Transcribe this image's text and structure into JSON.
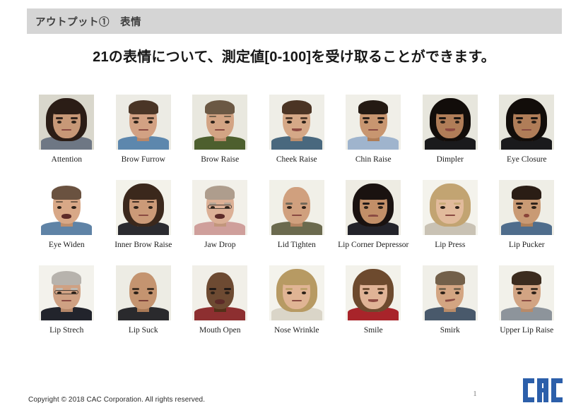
{
  "header": {
    "title": "アウトプット①　表情"
  },
  "slide": {
    "title": "21の表情について、測定値[0-100]を受け取ることができます。"
  },
  "grid": {
    "rows": [
      [
        {
          "label": "Attention",
          "photo": "portrait-attention",
          "skin": "#c79877",
          "hair": "#2b1d16",
          "bg": "#d9d7cc",
          "cloth": "#6e7784",
          "hairstyle": "long",
          "mouth": "closed"
        },
        {
          "label": "Brow Furrow",
          "photo": "portrait-brow-furrow",
          "skin": "#d2a183",
          "hair": "#4a3526",
          "bg": "#ecebe4",
          "cloth": "#5d87ad",
          "hairstyle": "short",
          "mouth": "closed"
        },
        {
          "label": "Brow Raise",
          "photo": "portrait-brow-raise",
          "skin": "#d3a484",
          "hair": "#6b5844",
          "bg": "#e9e8df",
          "cloth": "#4d5f2e",
          "hairstyle": "short",
          "mouth": "closed"
        },
        {
          "label": "Cheek Raise",
          "photo": "portrait-cheek-raise",
          "skin": "#d5a887",
          "hair": "#4b3424",
          "bg": "#efeee7",
          "cloth": "#49687e",
          "hairstyle": "short",
          "mouth": "smile"
        },
        {
          "label": "Chin Raise",
          "photo": "portrait-chin-raise",
          "skin": "#c89670",
          "hair": "#241a13",
          "bg": "#f0efe8",
          "cloth": "#9fb4cd",
          "hairstyle": "short",
          "mouth": "press"
        },
        {
          "label": "Dimpler",
          "photo": "portrait-dimpler",
          "skin": "#b07d58",
          "hair": "#120d0a",
          "bg": "#e7e6dd",
          "cloth": "#1a1a1c",
          "hairstyle": "long",
          "mouth": "smile"
        },
        {
          "label": "Eye Closure",
          "photo": "portrait-eye-closure",
          "skin": "#b07d58",
          "hair": "#120d0a",
          "bg": "#e7e6dd",
          "cloth": "#1a1a1c",
          "hairstyle": "long",
          "mouth": "closed"
        }
      ],
      [
        {
          "label": "Eye Widen",
          "photo": "portrait-eye-widen",
          "skin": "#d8a887",
          "hair": "#6a5240",
          "bg": "#ffffff",
          "cloth": "#5f83a6",
          "hairstyle": "short",
          "mouth": "open"
        },
        {
          "label": "Inner Brow Raise",
          "photo": "portrait-inner-brow-raise",
          "skin": "#cb9a78",
          "hair": "#3b281c",
          "bg": "#f3f2ea",
          "cloth": "#2b2b30",
          "hairstyle": "long",
          "mouth": "closed"
        },
        {
          "label": "Jaw Drop",
          "photo": "portrait-jaw-drop",
          "skin": "#dcb096",
          "hair": "#ae9d8d",
          "bg": "#f2f0e9",
          "cloth": "#cf9f9b",
          "hairstyle": "short",
          "mouth": "open"
        },
        {
          "label": "Lid Tighten",
          "photo": "portrait-lid-tighten",
          "skin": "#d0a07e",
          "hair": "#6d6252",
          "bg": "#f1f0e8",
          "cloth": "#6b6a4e",
          "hairstyle": "bald",
          "mouth": "press"
        },
        {
          "label": "Lip Corner Depressor",
          "photo": "portrait-lip-corner-depressor",
          "skin": "#c28f68",
          "hair": "#1a1210",
          "bg": "#eeece3",
          "cloth": "#23232a",
          "hairstyle": "long",
          "mouth": "frown"
        },
        {
          "label": "Lip Press",
          "photo": "portrait-lip-press",
          "skin": "#e2bb9c",
          "hair": "#c2a472",
          "bg": "#f4f3ec",
          "cloth": "#c9c2b4",
          "hairstyle": "long",
          "mouth": "press"
        },
        {
          "label": "Lip Pucker",
          "photo": "portrait-lip-pucker",
          "skin": "#c99a74",
          "hair": "#2a1d15",
          "bg": "#efeee6",
          "cloth": "#4f6d8c",
          "hairstyle": "short",
          "mouth": "pucker"
        }
      ],
      [
        {
          "label": "Lip Strech",
          "photo": "portrait-lip-strech",
          "skin": "#cfa183",
          "hair": "#b7b3ad",
          "bg": "#f3f2ec",
          "cloth": "#22242c",
          "hairstyle": "short",
          "mouth": "press"
        },
        {
          "label": "Lip Suck",
          "photo": "portrait-lip-suck",
          "skin": "#c49470",
          "hair": "#3a2a1d",
          "bg": "#edece4",
          "cloth": "#2a2a2d",
          "hairstyle": "bald",
          "mouth": "suck"
        },
        {
          "label": "Mouth Open",
          "photo": "portrait-mouth-open",
          "skin": "#6d4a32",
          "hair": "#191210",
          "bg": "#f1efe8",
          "cloth": "#8d2f30",
          "hairstyle": "bald",
          "mouth": "open"
        },
        {
          "label": "Nose Wrinkle",
          "photo": "portrait-nose-wrinkle",
          "skin": "#e0b494",
          "hair": "#b79a63",
          "bg": "#f4f3ec",
          "cloth": "#dad5c8",
          "hairstyle": "long",
          "mouth": "press"
        },
        {
          "label": "Smile",
          "photo": "portrait-smile",
          "skin": "#e0b396",
          "hair": "#6d4a2e",
          "bg": "#f3f2eb",
          "cloth": "#a8242a",
          "hairstyle": "long",
          "mouth": "smile"
        },
        {
          "label": "Smirk",
          "photo": "portrait-smirk",
          "skin": "#d3a582",
          "hair": "#73604a",
          "bg": "#f0efe8",
          "cloth": "#49596b",
          "hairstyle": "short",
          "mouth": "smirk"
        },
        {
          "label": "Upper Lip Raise",
          "photo": "portrait-upper-lip-raise",
          "skin": "#d2a483",
          "hair": "#3c2c1f",
          "bg": "#f2f1ea",
          "cloth": "#8d949b",
          "hairstyle": "short",
          "mouth": "press"
        }
      ]
    ]
  },
  "footer": {
    "copyright": "Copyright © 2018 CAC Corporation. All rights reserved.",
    "page_number": "1",
    "logo_text": "CAC",
    "logo_color": "#2c5faa"
  },
  "colors": {
    "header_bar": "#d5d5d5",
    "header_text": "#3f3f3f",
    "title_text": "#171717",
    "label_text": "#1d1d1d",
    "page_background": "#ffffff"
  }
}
